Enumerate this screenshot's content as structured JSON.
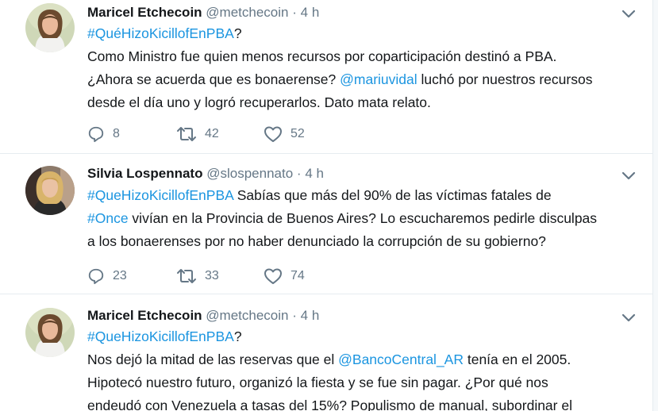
{
  "tweets": [
    {
      "name": "Maricel Etchecoin",
      "handle": "@metchecoin",
      "dot": "·",
      "time": "4 h",
      "lines": [
        [
          {
            "t": "#QuéHizoKicillofEnPBA",
            "c": "hash"
          },
          {
            "t": "?",
            "c": ""
          }
        ],
        [
          {
            "t": "Como Ministro fue quien menos recursos por coparticipación destinó a PBA.",
            "c": ""
          }
        ],
        [
          {
            "t": "¿Ahora se acuerda que es bonaerense? ",
            "c": ""
          },
          {
            "t": "@mariuvidal",
            "c": "mention"
          },
          {
            "t": " luchó por nuestros recursos",
            "c": ""
          }
        ],
        [
          {
            "t": "desde el día uno y logró recuperarlos. Dato mata relato.",
            "c": ""
          }
        ]
      ],
      "replies": "8",
      "retweets": "42",
      "likes": "52"
    },
    {
      "name": "Silvia Lospennato",
      "handle": "@slospennato",
      "dot": "·",
      "time": "4 h",
      "lines": [
        [
          {
            "t": "#QueHizoKicillofEnPBA",
            "c": "hash"
          },
          {
            "t": " Sabías que más del 90% de las víctimas fatales de",
            "c": ""
          }
        ],
        [
          {
            "t": "#Once",
            "c": "hash"
          },
          {
            "t": " vivían en la Provincia de Buenos Aires? Lo escucharemos pedirle disculpas",
            "c": ""
          }
        ],
        [
          {
            "t": "a los bonaerenses por no haber denunciado la corrupción de su gobierno?",
            "c": ""
          }
        ]
      ],
      "replies": "23",
      "retweets": "33",
      "likes": "74"
    },
    {
      "name": "Maricel Etchecoin",
      "handle": "@metchecoin",
      "dot": "·",
      "time": "4 h",
      "lines": [
        [
          {
            "t": "#QueHizoKicillofEnPBA",
            "c": "hash"
          },
          {
            "t": "?",
            "c": ""
          }
        ],
        [
          {
            "t": "Nos dejó la mitad de las reservas que el ",
            "c": ""
          },
          {
            "t": "@BancoCentral_AR",
            "c": "mention"
          },
          {
            "t": " tenía en el 2005.",
            "c": ""
          }
        ],
        [
          {
            "t": "Hipotecó nuestro futuro, organizó la fiesta y se fue sin pagar. ¿Por qué nos",
            "c": ""
          }
        ],
        [
          {
            "t": "endeudó con Venezuela a tasas del 15%? Populismo de manual, subordinar el",
            "c": ""
          }
        ]
      ]
    }
  ],
  "icons": {
    "reply": "reply-icon",
    "retweet": "retweet-icon",
    "like": "heart-icon",
    "caret": "chevron-down-icon"
  },
  "colors": {
    "link": "#1b95e0",
    "muted": "#657786",
    "text": "#14171a",
    "divider": "#e6ecf0"
  }
}
